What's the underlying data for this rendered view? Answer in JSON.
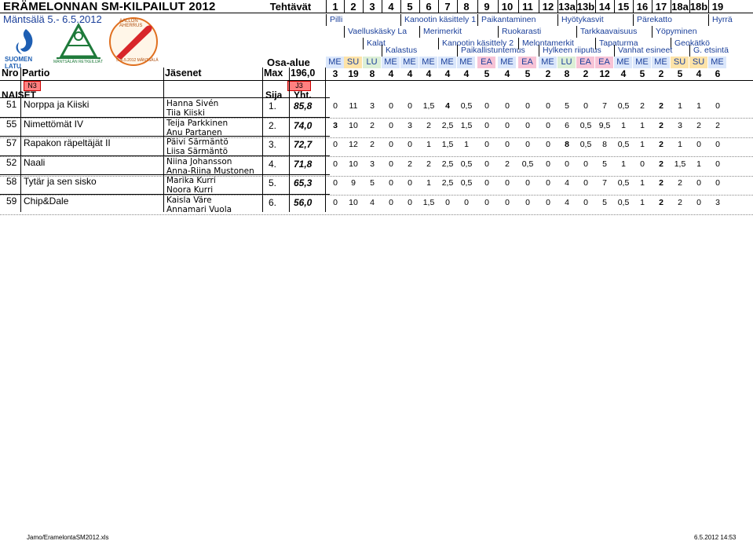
{
  "header": {
    "title": "ERÄMELONNAN SM-KILPAILUT 2012",
    "dates": "Mäntsälä 5.- 6.5.2012",
    "tehtavat_label": "Tehtävät",
    "task_numbers": [
      "1",
      "2",
      "3",
      "4",
      "5",
      "6",
      "7",
      "8",
      "9",
      "10",
      "11",
      "12",
      "13a",
      "13b",
      "14",
      "15",
      "16",
      "17",
      "18a",
      "18b",
      "19"
    ]
  },
  "logos": {
    "suomen_latu": "SUOMEN LATU",
    "mantsalan_retkeilijat": "MÄNTSÄLÄN RETKEILIJÄT",
    "aallon_aherrus": "AALLON AHERRUS",
    "aallon_date": "5.-6.5.2012 MÄNTSÄLÄ"
  },
  "tasks_row1": [
    "Pilli",
    "Kanootin käsittely 1",
    "Paikantaminen",
    "Hyötykasvit",
    "Pärekatto",
    "Hyrrä"
  ],
  "tasks_row2": [
    "Vaelluskäsky La",
    "Merimerkit",
    "Ruokarasti",
    "Tarkkaavaisuus",
    "Yöpyminen"
  ],
  "tasks_row3": [
    "Kalat",
    "Kanootin käsittely 2",
    "Melontamerkit",
    "Tapaturma",
    "Geokätkö"
  ],
  "tasks_row4": [
    "Kalastus",
    "Paikallistuntemus",
    "Hylkeen riiputus",
    "Vanhat esineet",
    "G. etsintä"
  ],
  "osa_alue_label": "Osa-alue",
  "categories": [
    "ME",
    "SU",
    "LU",
    "ME",
    "ME",
    "ME",
    "ME",
    "ME",
    "EA",
    "ME",
    "EA",
    "ME",
    "LU",
    "EA",
    "EA",
    "ME",
    "ME",
    "ME",
    "SU",
    "SU",
    "ME"
  ],
  "category_colors": {
    "ME": "#dbe7fb",
    "SU": "#fde3a8",
    "LU": "#dcefd6",
    "EA": "#f7c3d6"
  },
  "columns": {
    "nro": "Nro",
    "partio": "Partio",
    "jasenet": "Jäsenet",
    "max": "Max"
  },
  "max_total": "196,0",
  "max_values": [
    "3",
    "19",
    "8",
    "4",
    "4",
    "4",
    "4",
    "4",
    "5",
    "4",
    "5",
    "2",
    "8",
    "2",
    "12",
    "4",
    "5",
    "2",
    "5",
    "4",
    "6"
  ],
  "markers": {
    "n3": "N3",
    "j3": "J3"
  },
  "section": {
    "naiset": "NAISET",
    "sija": "Sija",
    "yht": "Yht."
  },
  "rows": [
    {
      "nro": "51",
      "partio": "Norppa ja Kiiski",
      "members": [
        "Hanna Sivén",
        "Tiia Kiiski"
      ],
      "sija": "1.",
      "yht": "85,8",
      "scores": [
        "0",
        "11",
        "3",
        "0",
        "0",
        "1,5",
        "4",
        "0,5",
        "0",
        "0",
        "0",
        "0",
        "5",
        "0",
        "7",
        "0,5",
        "2",
        "2",
        "1",
        "1",
        "0"
      ],
      "bold": [
        6,
        17
      ]
    },
    {
      "nro": "55",
      "partio": "Nimettömät IV",
      "members": [
        "Teija Parkkinen",
        "Anu Partanen"
      ],
      "sija": "2.",
      "yht": "74,0",
      "scores": [
        "3",
        "10",
        "2",
        "0",
        "3",
        "2",
        "2,5",
        "1,5",
        "0",
        "0",
        "0",
        "0",
        "6",
        "0,5",
        "9,5",
        "1",
        "1",
        "2",
        "3",
        "2",
        "2"
      ],
      "bold": [
        0,
        17
      ]
    },
    {
      "nro": "57",
      "partio": "Rapakon räpeltäjät II",
      "members": [
        "Päivi Särmäntö",
        "Liisa Särmäntö"
      ],
      "sija": "3.",
      "yht": "72,7",
      "scores": [
        "0",
        "12",
        "2",
        "0",
        "0",
        "1",
        "1,5",
        "1",
        "0",
        "0",
        "0",
        "0",
        "8",
        "0,5",
        "8",
        "0,5",
        "1",
        "2",
        "1",
        "0",
        "0"
      ],
      "bold": [
        12,
        17
      ]
    },
    {
      "nro": "52",
      "partio": "Naali",
      "members": [
        "Niina Johansson",
        "Anna-Riina Mustonen"
      ],
      "sija": "4.",
      "yht": "71,8",
      "scores": [
        "0",
        "10",
        "3",
        "0",
        "2",
        "2",
        "2,5",
        "0,5",
        "0",
        "2",
        "0,5",
        "0",
        "0",
        "0",
        "5",
        "1",
        "0",
        "2",
        "1,5",
        "1",
        "0"
      ],
      "bold": [
        17
      ]
    },
    {
      "nro": "58",
      "partio": "Tytär ja sen sisko",
      "members": [
        "Marika Kurri",
        "Noora Kurri"
      ],
      "sija": "5.",
      "yht": "65,3",
      "scores": [
        "0",
        "9",
        "5",
        "0",
        "0",
        "1",
        "2,5",
        "0,5",
        "0",
        "0",
        "0",
        "0",
        "4",
        "0",
        "7",
        "0,5",
        "1",
        "2",
        "2",
        "0",
        "0"
      ],
      "bold": [
        17
      ]
    },
    {
      "nro": "59",
      "partio": "Chip&Dale",
      "members": [
        "Kaisla Väre",
        "Annamari Vuola"
      ],
      "sija": "6.",
      "yht": "56,0",
      "scores": [
        "0",
        "10",
        "4",
        "0",
        "0",
        "1,5",
        "0",
        "0",
        "0",
        "0",
        "0",
        "0",
        "4",
        "0",
        "5",
        "0,5",
        "1",
        "2",
        "2",
        "0",
        "3"
      ],
      "bold": [
        17
      ]
    }
  ],
  "footer": {
    "left": "Jamo/EramelontaSM2012.xls",
    "right": "6.5.2012 14:53"
  }
}
